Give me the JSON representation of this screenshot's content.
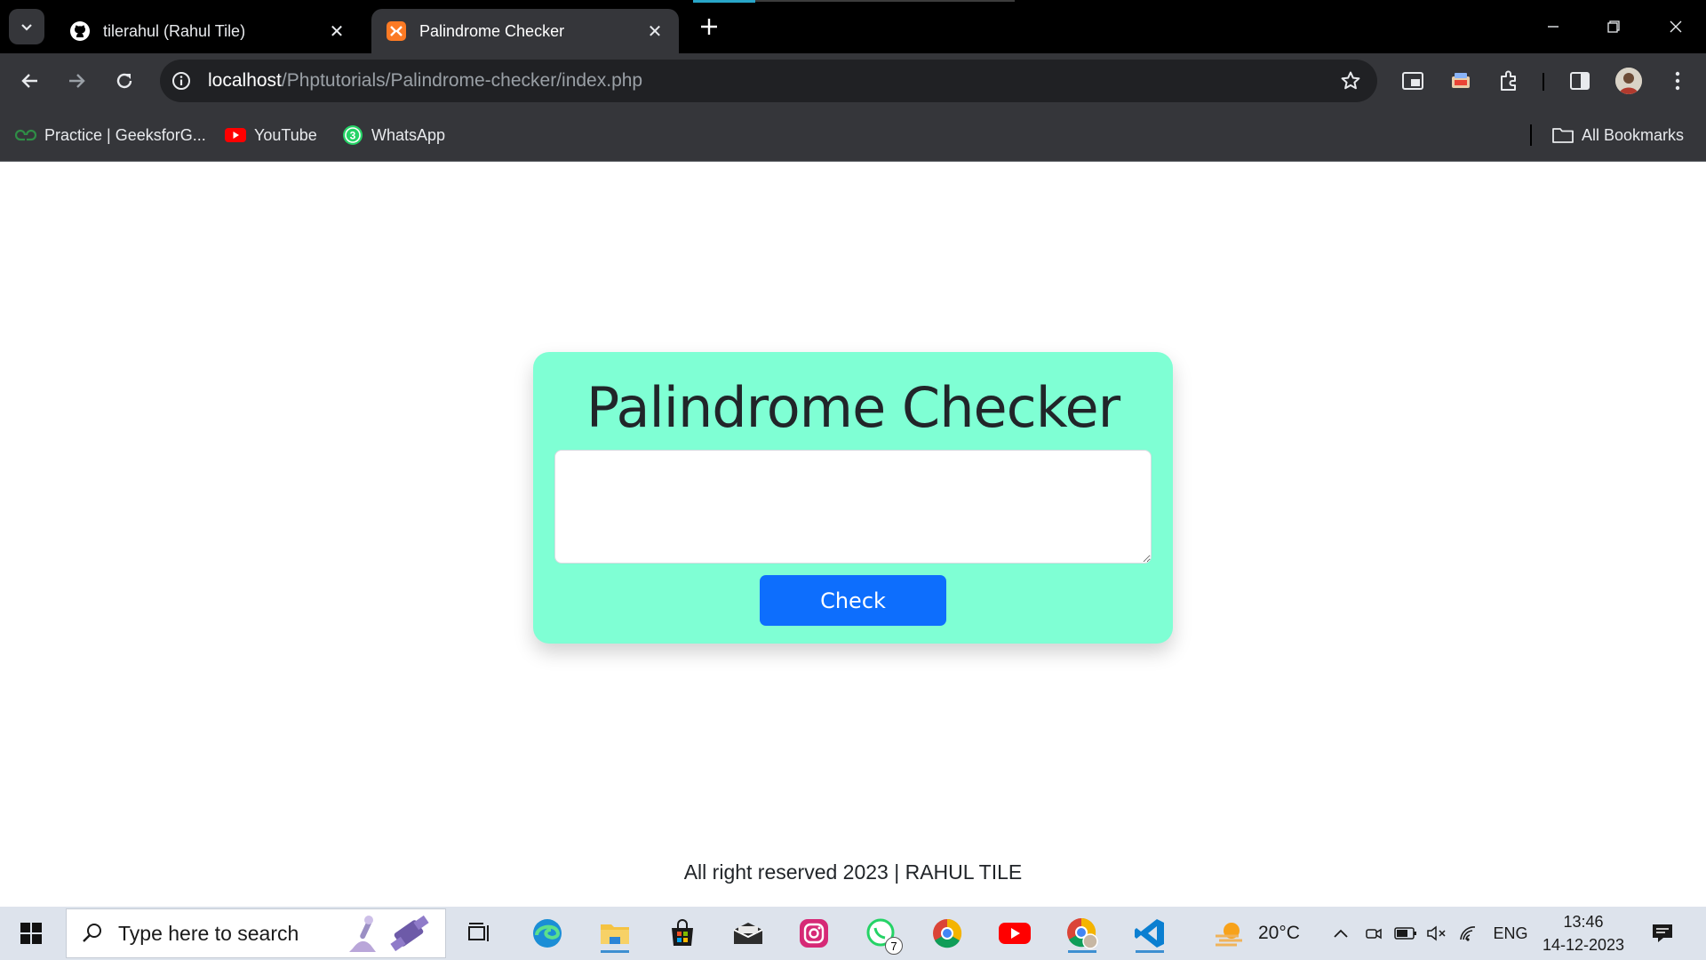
{
  "browser": {
    "tabs": [
      {
        "title": "tilerahul (Rahul Tile)",
        "favicon": "github-icon",
        "active": false
      },
      {
        "title": "Palindrome Checker",
        "favicon": "xampp-icon",
        "active": true
      }
    ],
    "url_host": "localhost",
    "url_path": "/Phptutorials/Palindrome-checker/index.php",
    "bookmarks": [
      {
        "label": "Practice | GeeksforG...",
        "icon": "geeksforgeeks-icon"
      },
      {
        "label": "YouTube",
        "icon": "youtube-icon"
      },
      {
        "label": "WhatsApp",
        "icon": "whatsapp-icon"
      }
    ],
    "whatsapp_badge": "3",
    "all_bookmarks_label": "All Bookmarks"
  },
  "page": {
    "title": "Palindrome Checker",
    "textarea_value": "",
    "check_label": "Check",
    "footer": "All right reserved 2023 | RAHUL TILE"
  },
  "taskbar": {
    "search_placeholder": "Type here to search",
    "whatsapp_count": "7",
    "temperature": "20°C",
    "language": "ENG",
    "time": "13:46",
    "date": "14-12-2023"
  },
  "colors": {
    "card_background": "#7fffd4",
    "button_primary": "#0d6efd",
    "browser_frame": "#35363a"
  }
}
